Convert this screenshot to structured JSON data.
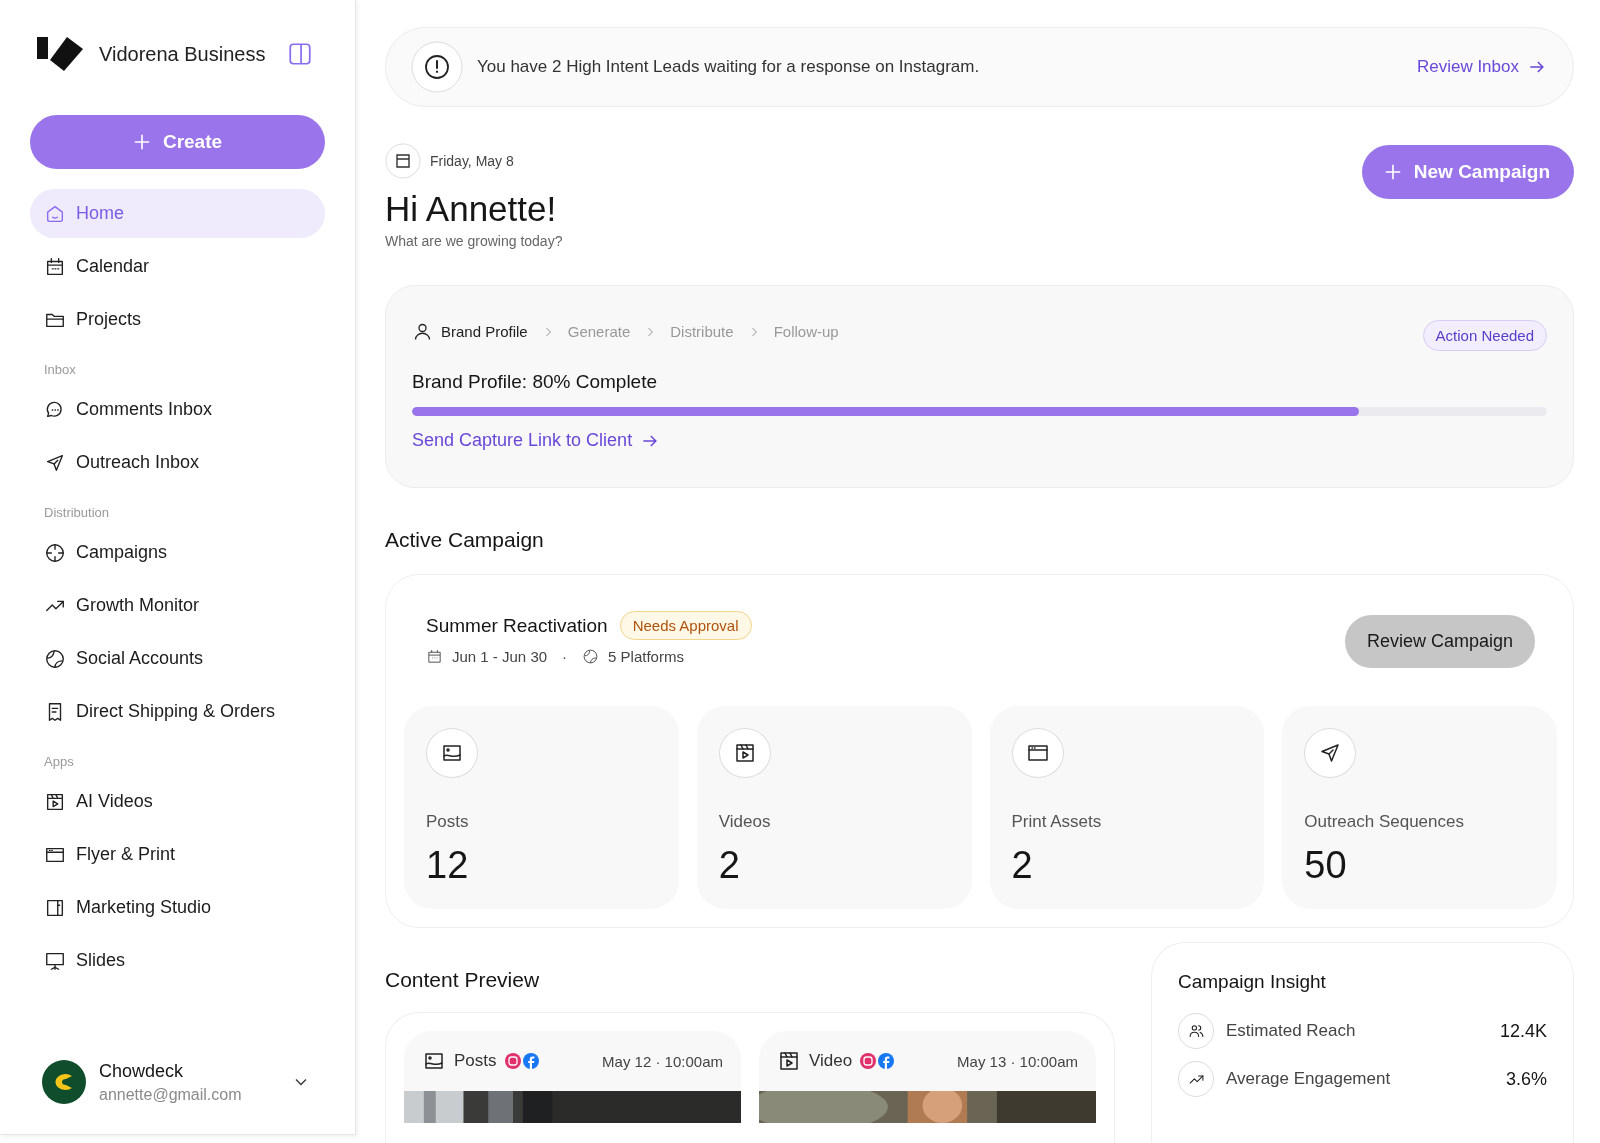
{
  "sidebar": {
    "brand": "Vidorena Business",
    "create": "Create",
    "sections": [
      {
        "items": [
          {
            "label": "Home",
            "selected": true
          },
          {
            "label": "Calendar",
            "selected": false
          },
          {
            "label": "Projects",
            "selected": false
          }
        ]
      },
      {
        "title": "Inbox",
        "items": [
          {
            "label": "Comments Inbox",
            "selected": false
          },
          {
            "label": "Outreach Inbox",
            "selected": false
          }
        ]
      },
      {
        "title": "Distribution",
        "items": [
          {
            "label": "Campaigns",
            "selected": false
          },
          {
            "label": "Growth Monitor",
            "selected": false
          },
          {
            "label": "Social Accounts",
            "selected": false
          },
          {
            "label": "Direct Shipping & Orders",
            "selected": false
          }
        ]
      },
      {
        "title": "Apps",
        "items": [
          {
            "label": "AI Videos",
            "selected": false
          },
          {
            "label": "Flyer & Print",
            "selected": false
          },
          {
            "label": "Marketing Studio",
            "selected": false
          },
          {
            "label": "Slides",
            "selected": false
          }
        ]
      }
    ],
    "account": {
      "name": "Chowdeck",
      "email": "annette@gmail.com"
    }
  },
  "alert": {
    "text": "You have 2 High Intent Leads waiting for a response on Instagram.",
    "link": "Review Inbox"
  },
  "header": {
    "date": "Friday, May 8",
    "greeting": "Hi Annette!",
    "subtitle": "What are we growing today?",
    "button": "New Campaign"
  },
  "onboarding": {
    "steps": [
      {
        "label": "Brand Profile",
        "selected": true
      },
      {
        "label": "Generate",
        "selected": false
      },
      {
        "label": "Distribute",
        "selected": false
      },
      {
        "label": "Follow-up",
        "selected": false
      }
    ],
    "badge": "Action Needed",
    "title": "Brand Profile: 80% Complete",
    "level": 0.834,
    "link": "Send Capture Link to Client"
  },
  "active_campaign": {
    "heading": "Active Campaign",
    "name": "Summer Reactivation",
    "status": "Needs Approval",
    "dates": "Jun 1 - Jun 30",
    "separator": "·",
    "platforms": "5 Platforms",
    "button": "Review Campaign",
    "stats": [
      {
        "label": "Posts",
        "value": "12"
      },
      {
        "label": "Videos",
        "value": "2"
      },
      {
        "label": "Print Assets",
        "value": "2"
      },
      {
        "label": "Outreach Sequences",
        "value": "50"
      }
    ]
  },
  "content_preview": {
    "heading": "Content Preview",
    "items": [
      {
        "type": "Posts",
        "date": "May 12 · 10:00am"
      },
      {
        "type": "Video",
        "date": "May 13 · 10:00am"
      }
    ]
  },
  "insight": {
    "title": "Campaign Insight",
    "rows": [
      {
        "label": "Estimated Reach",
        "value": "12.4K"
      },
      {
        "label": "Average Engagement",
        "value": "3.6%"
      }
    ]
  }
}
